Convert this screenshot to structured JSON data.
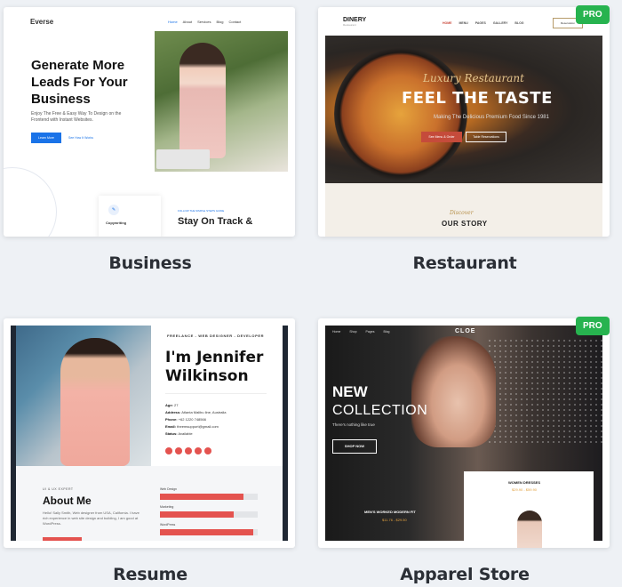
{
  "templates": [
    {
      "caption": "Business",
      "pro": false,
      "preview": {
        "logo": "Everse",
        "menu": [
          "Home",
          "About",
          "Services",
          "Blog",
          "Contact"
        ],
        "headline": "Generate More Leads For Your Business",
        "subtext": "Enjoy The Free & Easy Way To Design on the Frontend with Instant Websites.",
        "primary_button": "Learn More",
        "secondary_button": "See How It Works",
        "feature_label": "Copywriting",
        "small_label": "FOLLOW THE SIMPLE STEPS GUIDE",
        "section_title": "Stay On Track &"
      }
    },
    {
      "caption": "Restaurant",
      "pro": true,
      "pro_label": "PRO",
      "preview": {
        "logo": "DINERY",
        "logo_sub": "Restaurant",
        "menu": [
          "HOME",
          "MENU",
          "PAGES",
          "GALLERY",
          "BLOG"
        ],
        "reserve_button": "Reservation",
        "script": "Luxury Restaurant",
        "headline": "FEEL THE TASTE",
        "subtext": "Making The Delicious Premium Food Since 1981",
        "primary_button": "See Menu & Order",
        "secondary_button": "Table Reservations",
        "discover": "Discover",
        "section_title": "OUR STORY"
      }
    },
    {
      "caption": "Resume",
      "pro": false,
      "preview": {
        "tagline": "FREELANCE - WEB DESIGNER - DEVELOPER",
        "name": "I'm Jennifer Wilkinson",
        "info": [
          {
            "label": "Age:",
            "value": "27"
          },
          {
            "label": "Address:",
            "value": "Atlanta Malibu line, Australia"
          },
          {
            "label": "Phone:",
            "value": "+62 1220 748566"
          },
          {
            "label": "Email:",
            "value": "theemsupport@gmail.com"
          },
          {
            "label": "Status:",
            "value": "Available"
          }
        ],
        "about_tag": "UI & UX EXPERT",
        "about_title": "About Me",
        "about_text": "Hello! Sally Smith, Web designer from USA, California. I have rich experience in web site design and building, I am good at WordPress.",
        "skills": [
          {
            "name": "Web Design",
            "value": 0.85
          },
          {
            "name": "Marketing",
            "value": 0.75
          },
          {
            "name": "WordPress",
            "value": 0.95
          }
        ]
      }
    },
    {
      "caption": "Apparel Store",
      "pro": true,
      "pro_label": "PRO",
      "preview": {
        "menu": [
          "Home",
          "Shop",
          "Pages",
          "Blog"
        ],
        "logo": "CLOE",
        "headline_1": "NEW",
        "headline_2": "COLLECTION",
        "subtext": "There's nothing like true",
        "shop_button": "SHOP NOW",
        "men_label": "MEN'S WORKED MODERN FIT",
        "men_price": "$11.76 - $29.50",
        "women_label": "WOMEN DRESSES",
        "women_price": "$29.90 - $59.90"
      }
    }
  ]
}
